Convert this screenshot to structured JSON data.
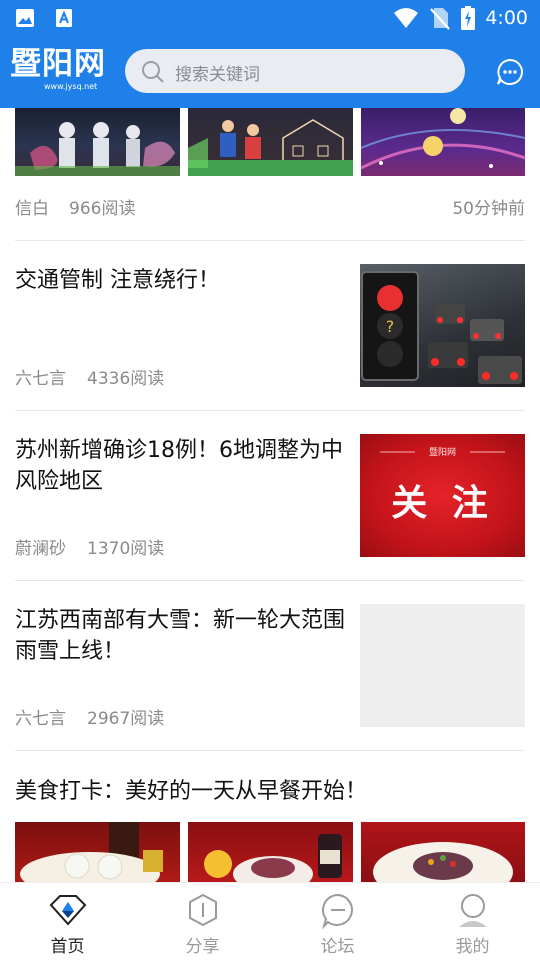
{
  "status_bar": {
    "time": "4:00",
    "icons": [
      "image-icon",
      "text-app-icon",
      "wifi-icon",
      "no-sim-icon",
      "battery-icon"
    ]
  },
  "header": {
    "logo_text": "暨阳网",
    "logo_subtext": "www.jysq.net",
    "search_placeholder": "搜索关键词",
    "accent_color": "#1e80e8"
  },
  "feed": {
    "top_item": {
      "author": "信白",
      "reads": "966阅读",
      "time": "50分钟前"
    },
    "articles": [
      {
        "title": "交通管制 注意绕行！",
        "author": "六七言",
        "reads": "4336阅读"
      },
      {
        "title": "苏州新增确诊18例！6地调整为中风险地区",
        "author": "蔚澜砂",
        "reads": "1370阅读",
        "thumb_logo": "暨阳网",
        "thumb_text": "关 注"
      },
      {
        "title": "江苏西南部有大雪：新一轮大范围雨雪上线！",
        "author": "六七言",
        "reads": "2967阅读"
      }
    ],
    "bottom_item": {
      "title": "美食打卡：美好的一天从早餐开始！"
    }
  },
  "tabs": [
    {
      "label": "首页",
      "icon": "home-diamond-icon",
      "active": true
    },
    {
      "label": "分享",
      "icon": "share-hexagon-icon",
      "active": false
    },
    {
      "label": "论坛",
      "icon": "forum-bubble-icon",
      "active": false
    },
    {
      "label": "我的",
      "icon": "profile-icon",
      "active": false
    }
  ]
}
